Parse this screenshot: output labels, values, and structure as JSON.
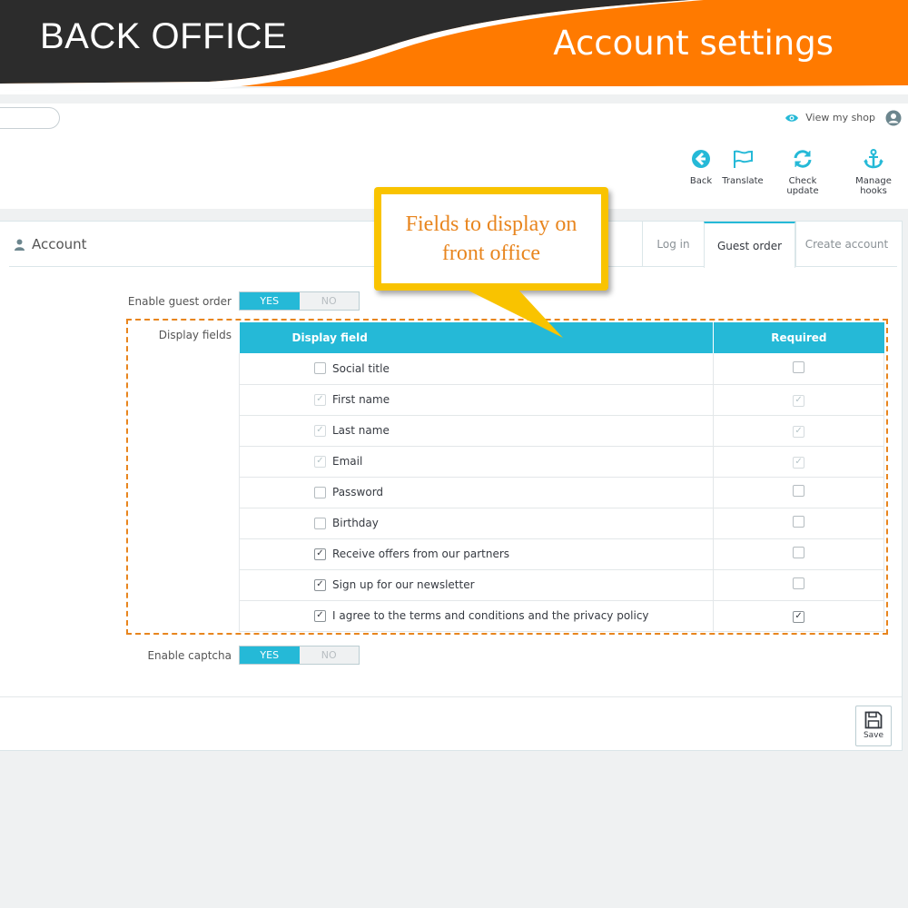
{
  "banner": {
    "left_title": "BACK OFFICE",
    "right_title": "Account settings",
    "accent_color": "#ff7a00",
    "dark_color": "#2c2c2c"
  },
  "header": {
    "view_shop_label": "View my shop",
    "toolbar": [
      {
        "label": "Back",
        "icon": "back-circle-icon"
      },
      {
        "label": "Translate",
        "icon": "flag-icon"
      },
      {
        "label": "Check update",
        "icon": "refresh-icon"
      },
      {
        "label": "Manage hooks",
        "icon": "anchor-icon"
      }
    ]
  },
  "panel": {
    "title": "Account",
    "tabs": [
      {
        "label": "Log in",
        "active": false
      },
      {
        "label": "Guest order",
        "active": true
      },
      {
        "label": "Create account",
        "active": false
      }
    ]
  },
  "form": {
    "guest_order_label": "Enable guest order",
    "guest_order": {
      "yes": "YES",
      "no": "NO",
      "value": "YES"
    },
    "display_fields_label": "Display fields",
    "table": {
      "headers": [
        "Display field",
        "Required"
      ],
      "rows": [
        {
          "field": "Social title",
          "display": "unchecked",
          "required": "unchecked"
        },
        {
          "field": "First name",
          "display": "disabled",
          "required": "disabled"
        },
        {
          "field": "Last name",
          "display": "disabled",
          "required": "disabled"
        },
        {
          "field": "Email",
          "display": "disabled",
          "required": "disabled"
        },
        {
          "field": "Password",
          "display": "unchecked",
          "required": "unchecked"
        },
        {
          "field": "Birthday",
          "display": "unchecked",
          "required": "unchecked"
        },
        {
          "field": "Receive offers from our partners",
          "display": "checked",
          "required": "unchecked"
        },
        {
          "field": "Sign up for our newsletter",
          "display": "checked",
          "required": "unchecked"
        },
        {
          "field": "I agree to the terms and conditions and the privacy policy",
          "display": "checked",
          "required": "checked"
        }
      ]
    },
    "captcha_label": "Enable captcha",
    "captcha": {
      "yes": "YES",
      "no": "NO",
      "value": "YES"
    },
    "save_label": "Save"
  },
  "callout": {
    "text": "Fields to display on front office",
    "border_color": "#f9c300",
    "text_color": "#e8851e"
  },
  "colors": {
    "primary": "#25b9d7",
    "highlight_border": "#e8851e"
  }
}
